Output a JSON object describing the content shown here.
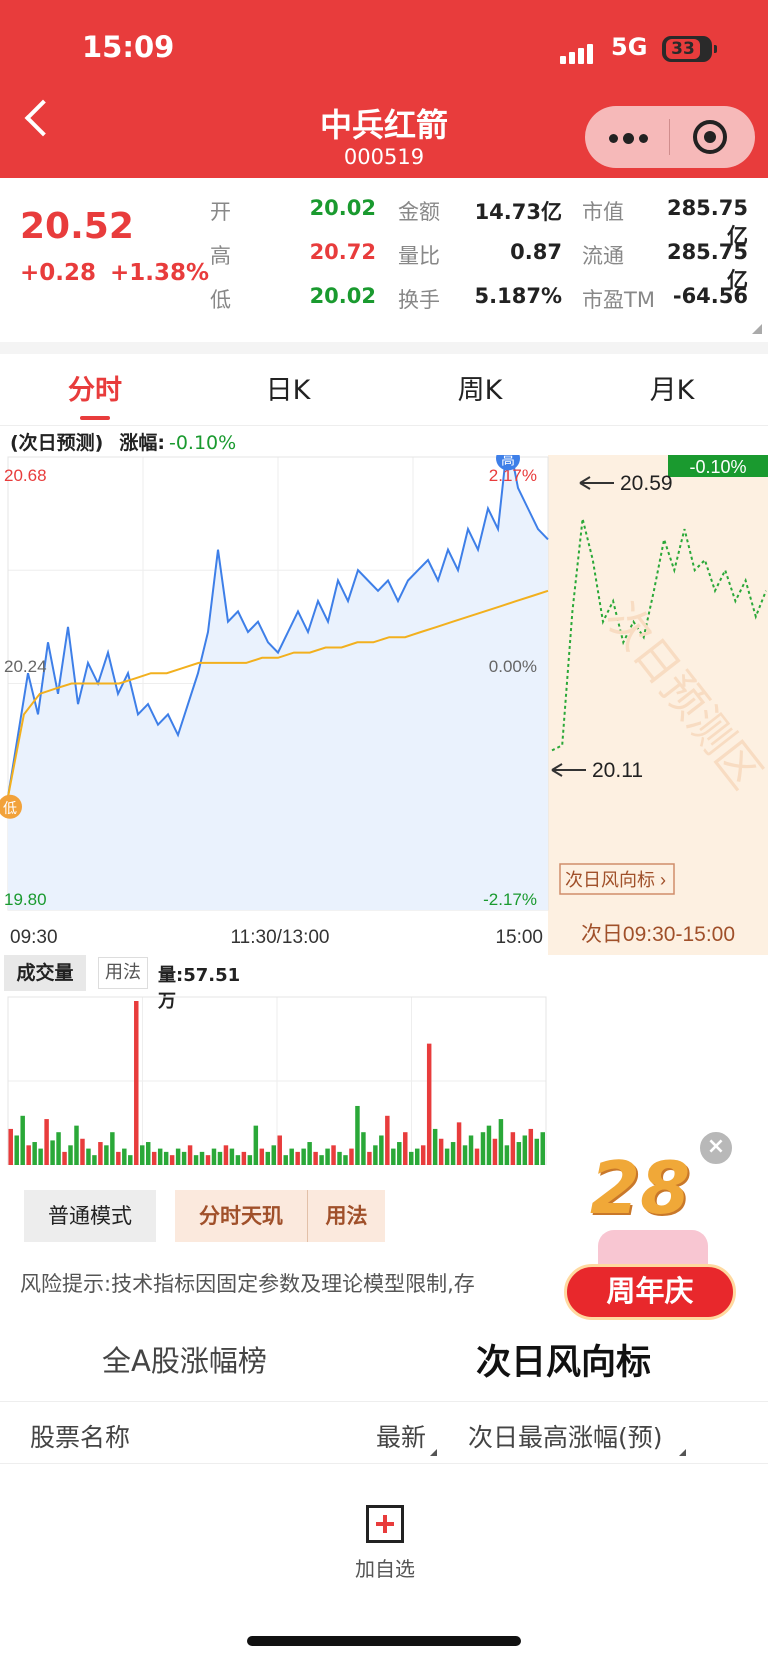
{
  "status_bar": {
    "time": "15:09",
    "network": "5G",
    "battery": "33"
  },
  "header": {
    "title": "中兵红箭",
    "code": "000519"
  },
  "quote": {
    "price": "20.52",
    "change": "+0.28",
    "change_pct": "+1.38%",
    "fields": [
      {
        "label": "开",
        "value": "20.02",
        "color": "#1a9a2f"
      },
      {
        "label": "金额",
        "value": "14.73亿",
        "color": "#222222"
      },
      {
        "label": "市值",
        "value": "285.75亿",
        "color": "#222222"
      },
      {
        "label": "高",
        "value": "20.72",
        "color": "#e83c3c"
      },
      {
        "label": "量比",
        "value": "0.87",
        "color": "#222222"
      },
      {
        "label": "流通",
        "value": "285.75亿",
        "color": "#222222"
      },
      {
        "label": "低",
        "value": "20.02",
        "color": "#1a9a2f"
      },
      {
        "label": "换手",
        "value": "5.187%",
        "color": "#222222"
      },
      {
        "label": "市盈TM",
        "value": "-64.56",
        "color": "#222222"
      }
    ]
  },
  "tabs": [
    "分时",
    "日K",
    "周K",
    "月K"
  ],
  "active_tab": "分时",
  "forecast": {
    "label": "(次日预测)",
    "change_label": "涨幅:",
    "change_value": "-0.10%"
  },
  "chart": {
    "y_top_label": "20.68",
    "y_mid_label": "20.24",
    "y_bottom_label": "19.80",
    "pct_top": "2.17%",
    "pct_mid": "0.00%",
    "pct_bottom": "-2.17%",
    "x_labels": [
      "09:30",
      "11:30/13:00",
      "15:00"
    ],
    "high_marker": "高",
    "low_marker": "低",
    "forecast_badge": "-0.10%",
    "forecast_high": "20.59",
    "forecast_low": "20.11",
    "forecast_watermark": "次日预测区",
    "forecast_link": "次日风向标",
    "forecast_time": "次日09:30-15:00"
  },
  "chart_data": {
    "type": "line",
    "title": "",
    "y_range": [
      19.8,
      20.68
    ],
    "series": [
      {
        "name": "",
        "values": [
          20.02,
          20.14,
          20.26,
          20.18,
          20.32,
          20.22,
          20.35,
          20.2,
          20.28,
          20.24,
          20.3,
          20.22,
          20.26,
          20.18,
          20.2,
          20.16,
          20.18,
          20.14,
          20.2,
          20.26,
          20.34,
          20.5,
          20.36,
          20.38,
          20.34,
          20.36,
          20.32,
          20.3,
          20.34,
          20.38,
          20.34,
          20.4,
          20.36,
          20.44,
          20.4,
          20.46,
          20.44,
          20.42,
          20.44,
          20.4,
          20.44,
          20.46,
          20.48,
          20.44,
          20.5,
          20.46,
          20.54,
          20.5,
          20.58,
          20.54,
          20.72,
          20.62,
          20.58,
          20.54,
          20.52
        ]
      },
      {
        "name": "",
        "values": [
          20.02,
          20.18,
          20.22,
          20.23,
          20.24,
          20.24,
          20.24,
          20.24,
          20.25,
          20.26,
          20.26,
          20.27,
          20.28,
          20.28,
          20.28,
          20.28,
          20.29,
          20.29,
          20.3,
          20.3,
          20.31,
          20.31,
          20.32,
          20.32,
          20.33,
          20.33,
          20.34,
          20.35,
          20.36,
          20.37,
          20.38,
          20.39,
          20.4,
          20.41,
          20.42
        ]
      }
    ],
    "forecast_series": [
      20.11,
      20.12,
      20.38,
      20.56,
      20.48,
      20.36,
      20.4,
      20.32,
      20.36,
      20.33,
      20.42,
      20.52,
      20.46,
      20.54,
      20.46,
      20.48,
      20.42,
      20.46,
      20.4,
      20.44,
      20.37,
      20.42
    ],
    "volume": [
      22,
      18,
      30,
      12,
      14,
      10,
      28,
      15,
      20,
      8,
      12,
      24,
      16,
      10,
      6,
      14,
      12,
      20,
      8,
      10,
      6,
      100,
      12,
      14,
      8,
      10,
      8,
      6,
      10,
      8,
      12,
      6,
      8,
      6,
      10,
      8,
      12,
      10,
      6,
      8,
      6,
      24,
      10,
      8,
      12,
      18,
      6,
      10,
      8,
      10,
      14,
      8,
      6,
      10,
      12,
      8,
      6,
      10,
      36,
      20,
      8,
      12,
      18,
      30,
      10,
      14,
      20,
      8,
      10,
      12,
      74,
      22,
      16,
      10,
      14,
      26,
      12,
      18,
      10,
      20,
      24,
      16,
      28,
      12,
      20,
      14,
      18,
      22,
      16,
      20
    ],
    "volume_max_label": "量:57.51万"
  },
  "volume": {
    "tag": "成交量",
    "usage": "用法",
    "amount": "量:57.51万"
  },
  "mode_buttons": {
    "normal": "普通模式",
    "tianji": "分时天玑",
    "usage": "用法"
  },
  "risk_text": "风险提示:技术指标因固定参数及理论模型限制,存",
  "promo": {
    "number": "28",
    "label": "周年庆",
    "close": "×"
  },
  "rank_tabs": {
    "all_a": "全A股涨幅榜",
    "next_day": "次日风向标"
  },
  "list_header": {
    "name": "股票名称",
    "latest": "最新",
    "next_high": "次日最高涨幅(预)"
  },
  "add_favorite": "加自选"
}
